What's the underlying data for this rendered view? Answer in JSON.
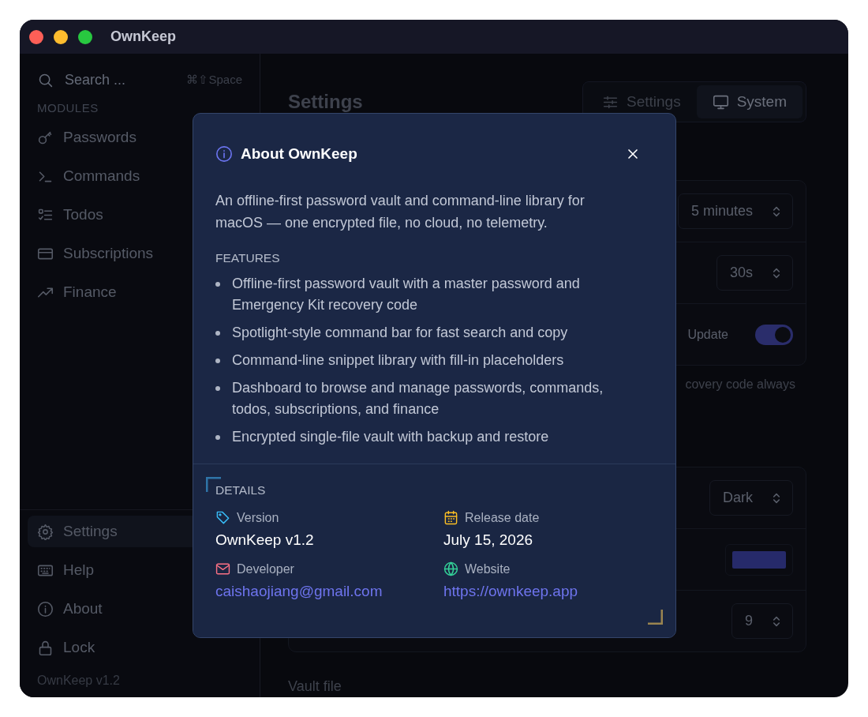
{
  "window": {
    "title": "OwnKeep"
  },
  "sidebar": {
    "search": {
      "placeholder": "Search ...",
      "shortcut": "⌘⇧Space"
    },
    "section_label": "MODULES",
    "modules": [
      {
        "label": "Passwords",
        "selected": false
      },
      {
        "label": "Commands",
        "selected": false
      },
      {
        "label": "Todos",
        "selected": false
      },
      {
        "label": "Subscriptions",
        "selected": false
      },
      {
        "label": "Finance",
        "selected": false
      }
    ],
    "footer_items": [
      {
        "label": "Settings",
        "selected": true
      },
      {
        "label": "Help",
        "selected": false
      },
      {
        "label": "About",
        "selected": false
      },
      {
        "label": "Lock",
        "selected": false
      }
    ],
    "version": "OwnKeep v1.2"
  },
  "main": {
    "heading": "Settings",
    "tabs": [
      {
        "label": "Settings",
        "selected": false
      },
      {
        "label": "System",
        "selected": true
      }
    ],
    "general_rows": [
      {
        "kind": "select",
        "value": "5 minutes"
      },
      {
        "kind": "select",
        "value": "30s"
      },
      {
        "kind": "toggle",
        "label": "Update",
        "on": true
      }
    ],
    "hint": "covery code always",
    "appearance_rows": [
      {
        "kind": "select",
        "value": "Dark"
      },
      {
        "kind": "swatch"
      },
      {
        "kind": "select",
        "value": "9"
      }
    ],
    "section_label": "Vault file"
  },
  "dialog": {
    "title": "About OwnKeep",
    "description": "An offline-first password vault and command-line library for macOS — one encrypted file, no cloud, no telemetry.",
    "features_label": "FEATURES",
    "features": [
      "Offline-first password vault with a master password and Emergency Kit recovery code",
      "Spotlight-style command bar for fast search and copy",
      "Command-line snippet library with fill-in placeholders",
      "Dashboard to browse and manage passwords, commands, todos, subscriptions, and finance",
      "Encrypted single-file vault with backup and restore"
    ],
    "details_label": "DETAILS",
    "details": [
      {
        "label": "Version",
        "value": "OwnKeep v1.2",
        "kind": "text"
      },
      {
        "label": "Release date",
        "value": "July 15, 2026",
        "kind": "text"
      },
      {
        "label": "Developer",
        "value": "caishaojiang@gmail.com",
        "kind": "link"
      },
      {
        "label": "Website",
        "value": "https://ownkeep.app",
        "kind": "link"
      }
    ]
  }
}
